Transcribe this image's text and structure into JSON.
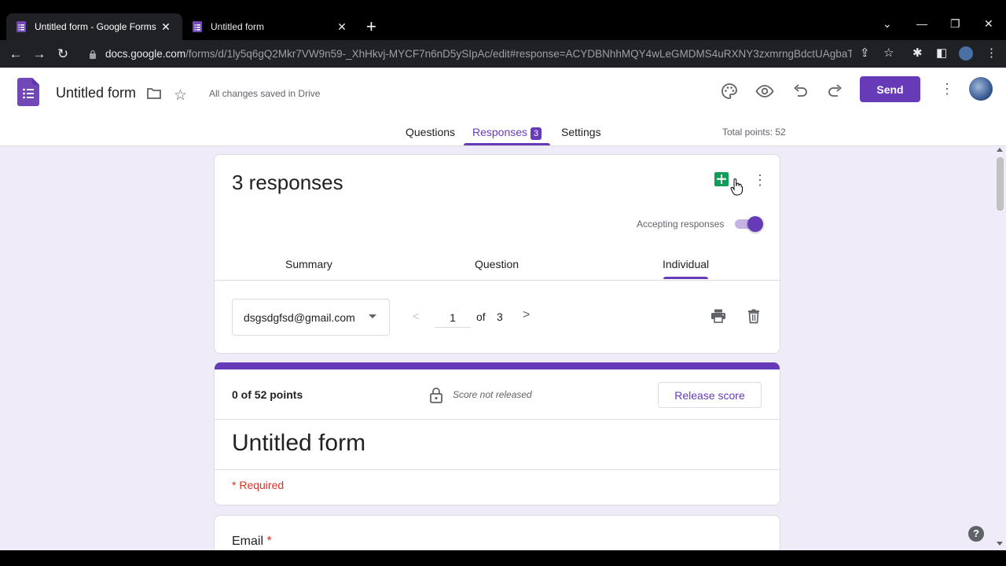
{
  "browser": {
    "tabs": [
      {
        "title": "Untitled form - Google Forms",
        "active": true
      },
      {
        "title": "Untitled form",
        "active": false
      }
    ],
    "url_host": "docs.google.com",
    "url_path": "/forms/d/1ly5q6gQ2Mkr7VW9n59-_XhHkvj-MYCF7n6nD5ySIpAc/edit#response=ACYDBNhhMQY4wLeGMDMS4uRXNY3zxmrngBdctUAgbaT_7oo...",
    "close_glyph": "✕",
    "newtab_glyph": "+",
    "minimize_glyph": "—",
    "restore_glyph": "❐",
    "chevron_glyph": "⌄"
  },
  "header": {
    "doc_title": "Untitled form",
    "saved_status": "All changes saved in Drive",
    "send_label": "Send",
    "accent": "#673ab7",
    "tabs": {
      "questions": "Questions",
      "responses": "Responses",
      "responses_count": "3",
      "settings": "Settings"
    },
    "total_points": "Total points: 52"
  },
  "summary": {
    "title": "3 responses",
    "accepting_label": "Accepting responses",
    "accepting_on": true,
    "subtabs": {
      "summary": "Summary",
      "question": "Question",
      "individual": "Individual"
    },
    "respondent": "dsgsdgfsd@gmail.com",
    "page_current": "1",
    "page_of": "of",
    "page_total": "3"
  },
  "score": {
    "points": "0 of 52 points",
    "status": "Score not released",
    "release_label": "Release score",
    "form_title": "Untitled form",
    "required_note": "* Required"
  },
  "question": {
    "label": "Email",
    "required_mark": "*"
  },
  "help_glyph": "?"
}
